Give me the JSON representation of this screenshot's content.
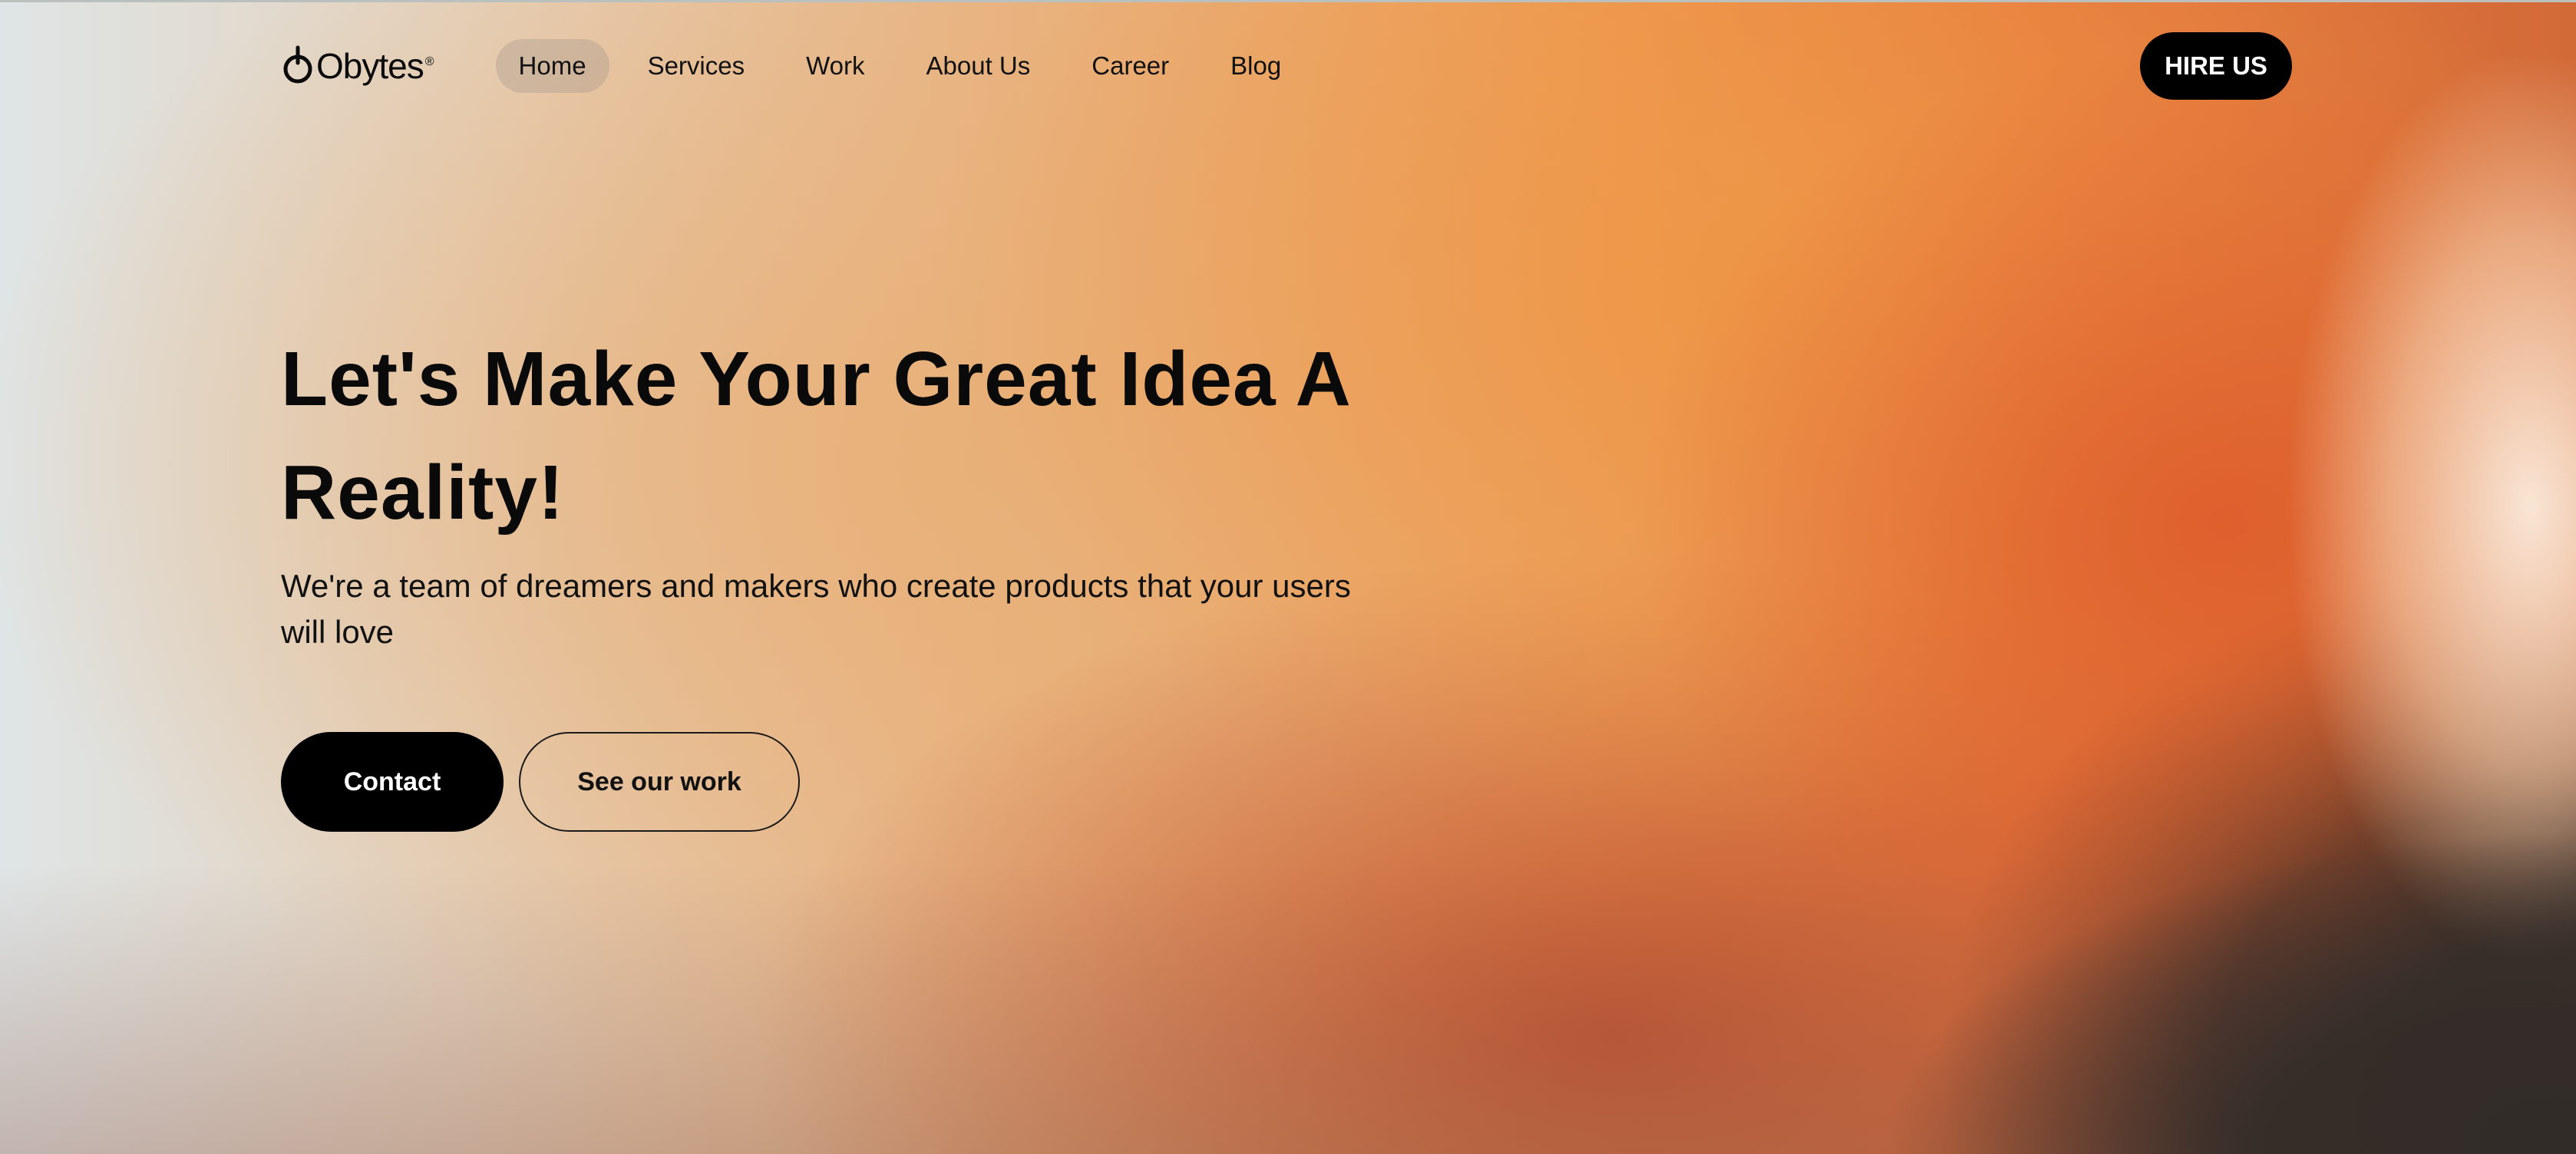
{
  "brand": {
    "logo_text": "Obytes",
    "logo_mark": "®"
  },
  "nav": {
    "items": [
      {
        "label": "Home",
        "active": true
      },
      {
        "label": "Services",
        "active": false
      },
      {
        "label": "Work",
        "active": false
      },
      {
        "label": "About Us",
        "active": false
      },
      {
        "label": "Career",
        "active": false
      },
      {
        "label": "Blog",
        "active": false
      }
    ],
    "hire_label": "HIRE US"
  },
  "hero": {
    "title_line1": "Let's Make Your Great Idea A",
    "title_line2": "Reality!",
    "subtitle": "We're a team of dreamers and makers who create products that your users will love",
    "contact_label": "Contact",
    "work_label": "See our work"
  },
  "colors": {
    "accent_primary": "#000000",
    "background_warm": "#ee9a50",
    "background_deep": "#de5e2c",
    "background_dark": "#302a26",
    "background_cool": "#dfe5e6"
  },
  "icons": {
    "logo": "obytes-power-icon"
  }
}
